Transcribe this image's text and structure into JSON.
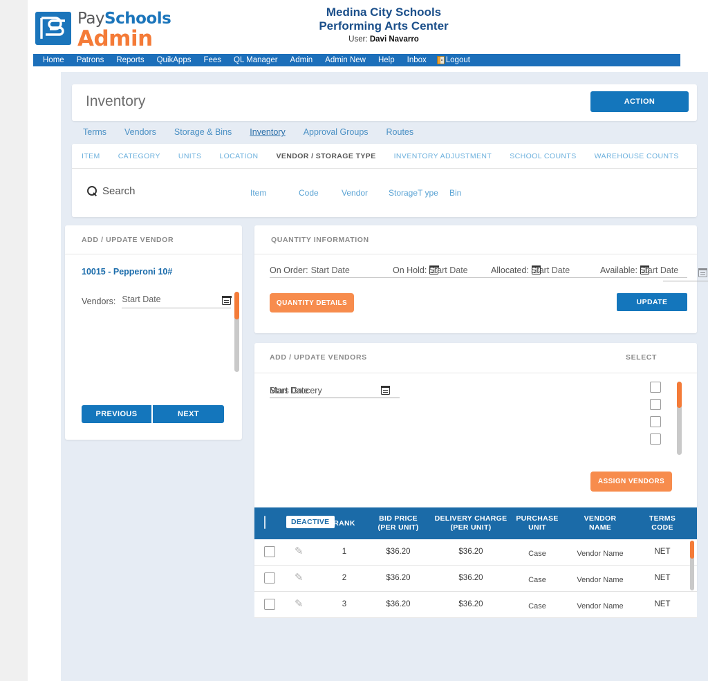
{
  "brand": {
    "logo_pay": "Pay",
    "logo_schools": "Schools",
    "logo_admin": "Admin",
    "accent_blue": "#1476bc",
    "accent_orange": "#f47b38"
  },
  "header": {
    "org_line1": "Medina City Schools",
    "org_line2": "Performing Arts Center",
    "user_label": "User:",
    "user_name": "Davi Navarro"
  },
  "nav": {
    "items": [
      {
        "label": "Home"
      },
      {
        "label": "Patrons"
      },
      {
        "label": "Reports"
      },
      {
        "label": "QuikApps"
      },
      {
        "label": "Fees"
      },
      {
        "label": "QL Manager"
      },
      {
        "label": "Admin"
      },
      {
        "label": "Admin New"
      },
      {
        "label": "Help"
      },
      {
        "label": "Inbox"
      }
    ],
    "logout_label": "Logout",
    "logout_icon": "door-exit-icon"
  },
  "page": {
    "title": "Inventory",
    "action_label": "ACTION"
  },
  "tabs": [
    {
      "label": "Terms",
      "active": false
    },
    {
      "label": "Vendors",
      "active": false
    },
    {
      "label": "Storage & Bins",
      "active": false
    },
    {
      "label": "Inventory",
      "active": true
    },
    {
      "label": "Approval Groups",
      "active": false
    },
    {
      "label": "Routes",
      "active": false
    }
  ],
  "subtabs": [
    {
      "label": "ITEM",
      "active": false
    },
    {
      "label": "CATEGORY",
      "active": false
    },
    {
      "label": "UNITS",
      "active": false
    },
    {
      "label": "LOCATION",
      "active": false
    },
    {
      "label": "VENDOR / STORAGE TYPE",
      "active": true
    },
    {
      "label": "INVENTORY ADJUSTMENT",
      "active": false
    },
    {
      "label": "SCHOOL COUNTS",
      "active": false
    },
    {
      "label": "WAREHOUSE COUNTS",
      "active": false
    }
  ],
  "search": {
    "label": "Search",
    "icon": "search-icon",
    "fields": [
      {
        "label": "Item"
      },
      {
        "label": "Code"
      },
      {
        "label": "Vendor"
      },
      {
        "label": "StorageT ype"
      },
      {
        "label": "Bin"
      }
    ]
  },
  "left_panel": {
    "heading": "ADD / UPDATE VENDOR",
    "item_name": "10015 - Pepperoni 10#",
    "vendors_label": "Vendors:",
    "vendors_value": "Start Date",
    "calendar_icon": "calendar-icon",
    "previous_label": "PREVIOUS",
    "next_label": "NEXT"
  },
  "quantity_panel": {
    "heading": "QUANTITY INFORMATION",
    "fields": [
      {
        "label": "On Order:",
        "value": "Start Date"
      },
      {
        "label": "On Hold:",
        "value": "Start Date"
      },
      {
        "label": "Allocated:",
        "value": "Start Date"
      },
      {
        "label": "Available:",
        "value": "Start Date"
      }
    ],
    "details_label": "QUANTITY DETAILS",
    "update_label": "UPDATE"
  },
  "vendors_panel": {
    "heading": "ADD / UPDATE VENDORS",
    "select_heading": "SELECT",
    "field_value_a": "Start Date",
    "field_value_b": "Mars Grocery",
    "calendar_icon": "calendar-icon",
    "assign_label": "ASSIGN VENDORS"
  },
  "bid_table": {
    "deactive_label": "DEACTIVE",
    "columns": [
      {
        "line1": "RANK",
        "line2": ""
      },
      {
        "line1": "BID PRICE",
        "line2": "(PER UNIT)"
      },
      {
        "line1": "DELIVERY CHARGE",
        "line2": "(PER UNIT)"
      },
      {
        "line1": "PURCHASE",
        "line2": "UNIT"
      },
      {
        "line1": "VENDOR",
        "line2": "NAME"
      },
      {
        "line1": "TERMS",
        "line2": "CODE"
      }
    ],
    "rows": [
      {
        "rank": "1",
        "bid_price": "$36.20",
        "delivery_charge": "$36.20",
        "purchase_unit": "Case",
        "vendor_name": "Vendor Name",
        "terms_code": "NET"
      },
      {
        "rank": "2",
        "bid_price": "$36.20",
        "delivery_charge": "$36.20",
        "purchase_unit": "Case",
        "vendor_name": "Vendor Name",
        "terms_code": "NET"
      },
      {
        "rank": "3",
        "bid_price": "$36.20",
        "delivery_charge": "$36.20",
        "purchase_unit": "Case",
        "vendor_name": "Vendor Name",
        "terms_code": "NET"
      }
    ]
  }
}
